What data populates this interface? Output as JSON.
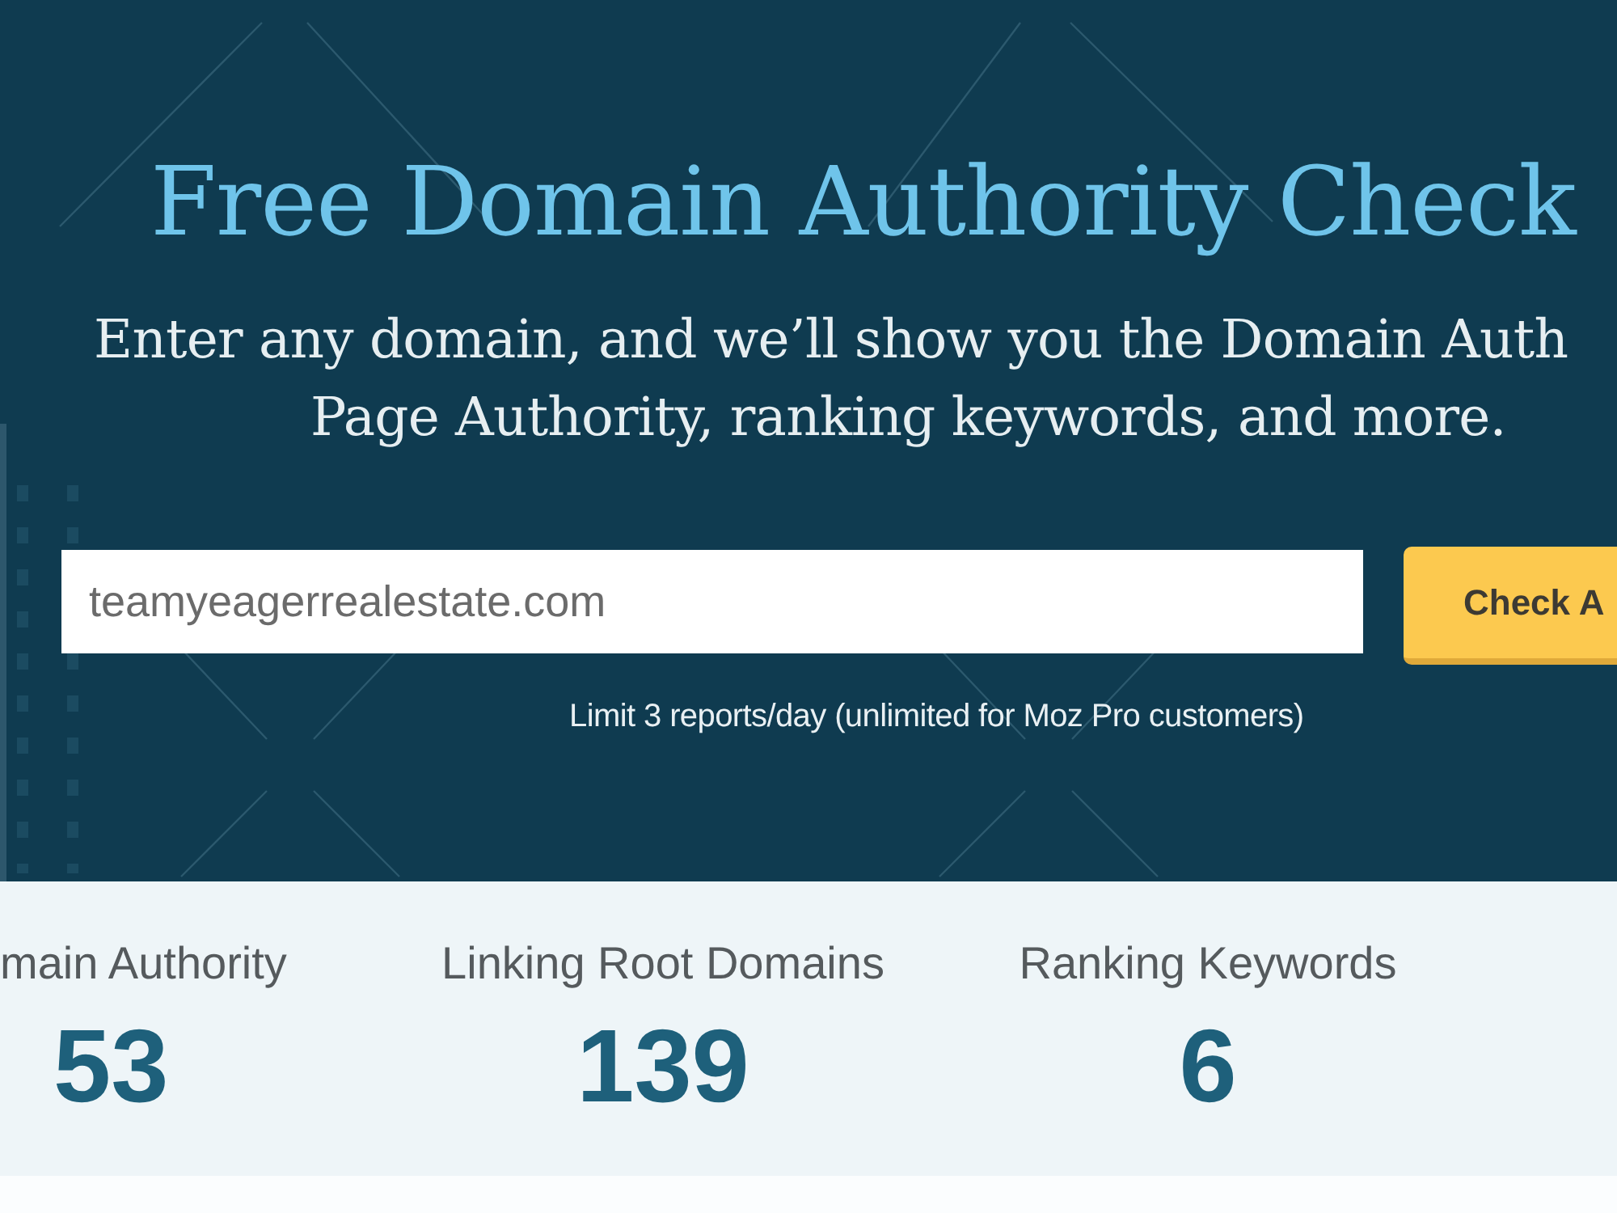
{
  "hero": {
    "title": "Free Domain Authority Check",
    "subtitle_lines": [
      "Enter any domain, and we’ll show you the Domain Auth",
      "Page Authority, ranking keywords, and more."
    ],
    "domain_field": {
      "value": "teamyeagerrealestate.com"
    },
    "check_button": {
      "label": "Check A"
    },
    "limit_note": "Limit 3 reports/day (unlimited for Moz Pro customers)"
  },
  "metrics": [
    {
      "label": "main Authority",
      "value": "53"
    },
    {
      "label": "Linking Root Domains",
      "value": "139"
    },
    {
      "label": "Ranking Keywords",
      "value": "6"
    }
  ]
}
